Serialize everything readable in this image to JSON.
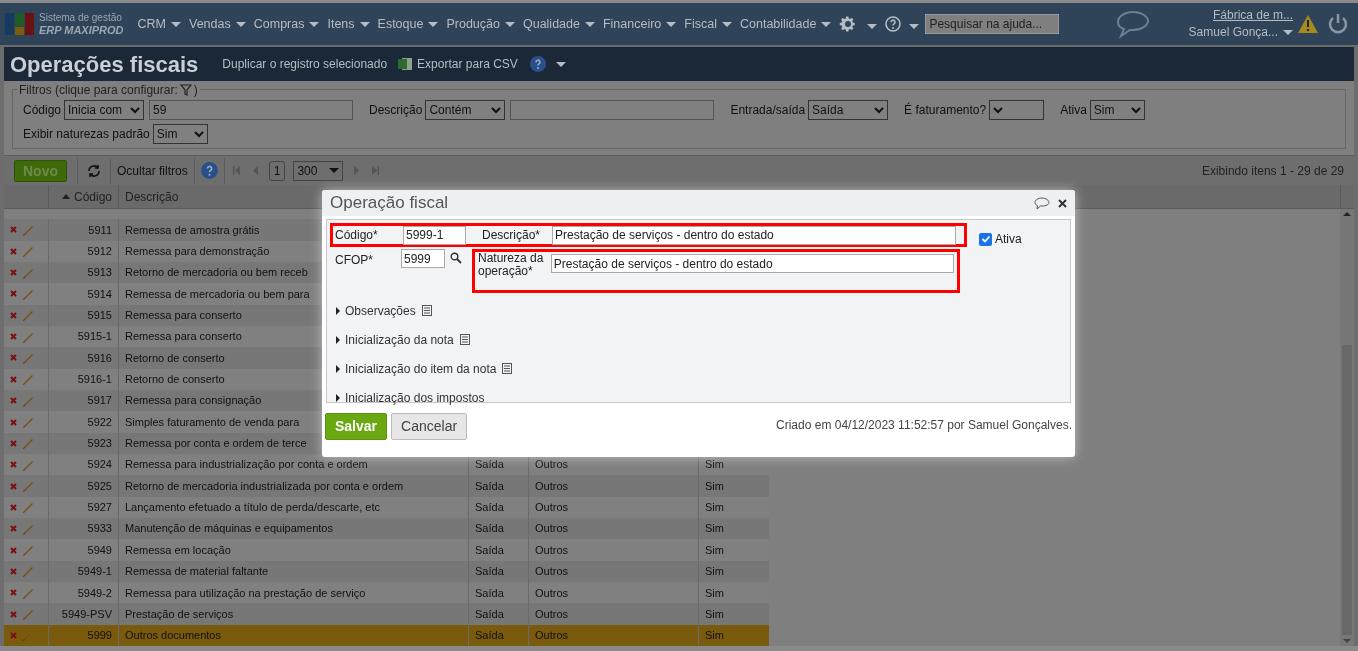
{
  "nav": {
    "logo_top": "Sistema de gestão",
    "logo_bottom": "ERP MAXIPROD",
    "menus": [
      "CRM",
      "Vendas",
      "Compras",
      "Itens",
      "Estoque",
      "Produção",
      "Qualidade",
      "Financeiro",
      "Fiscal",
      "Contabilidade"
    ],
    "help_search": {
      "placeholder": "Pesquisar na ajuda..."
    },
    "company": "Fábrica de m...",
    "user": "Samuel Gonça..."
  },
  "page": {
    "title": "Operações fiscais",
    "actions": [
      {
        "kind": "duplicate",
        "label": "Duplicar o registro selecionado"
      },
      {
        "kind": "export",
        "label": "Exportar para CSV"
      }
    ]
  },
  "filters": {
    "legend_start": "Filtros (clique para configurar:",
    "legend_end": ")",
    "rows": [
      [
        {
          "kind": "text",
          "label": "Código",
          "operator": "Inicia com",
          "value": "59"
        },
        {
          "kind": "text",
          "label": "Descrição",
          "operator": "Contém"
        },
        {
          "kind": "select",
          "label": "Entrada/saída",
          "operator": "Saída"
        },
        {
          "kind": "select",
          "label": "É faturamento?"
        },
        {
          "kind": "select",
          "label": "Ativa",
          "operator": "Sim"
        }
      ],
      [
        {
          "kind": "select",
          "label": "Exibir naturezas padrão",
          "operator": "Sim"
        }
      ]
    ]
  },
  "toolbar": {
    "new": "Novo",
    "hide_filters": "Ocultar filtros",
    "page": "1",
    "page_size": "300",
    "status": "Exibindo itens 1 - 29 de 29"
  },
  "table": {
    "columns": [
      "Código",
      "Descrição"
    ],
    "rows": [
      {
        "code": "5911",
        "description": "Remessa de amostra grátis",
        "selected": false
      },
      {
        "code": "5912",
        "description": "Remessa para demonstração",
        "selected": false
      },
      {
        "code": "5913",
        "description": "Retorno de mercadoria ou bem receb",
        "selected": false
      },
      {
        "code": "5914",
        "description": "Remessa de mercadoria ou bem para",
        "selected": false
      },
      {
        "code": "5915",
        "description": "Remessa para conserto",
        "selected": false
      },
      {
        "code": "5915-1",
        "description": "Remessa para conserto",
        "selected": false
      },
      {
        "code": "5916",
        "description": "Retorno de conserto",
        "selected": false
      },
      {
        "code": "5916-1",
        "description": "Retorno de conserto",
        "selected": false
      },
      {
        "code": "5917",
        "description": "Remessa para consignação",
        "selected": false
      },
      {
        "code": "5922",
        "description": "Simples faturamento de venda para",
        "selected": false
      },
      {
        "code": "5923",
        "description": "Remessa por conta e ordem de terce",
        "selected": false
      },
      {
        "code": "5924",
        "description": "Remessa para industrialização por conta e ordem",
        "direction": "Saída",
        "nature": "Outros",
        "active": "Sim",
        "selected": false
      },
      {
        "code": "5925",
        "description": "Retorno de mercadoria industrializada por conta e ordem",
        "direction": "Saída",
        "nature": "Outros",
        "active": "Sim",
        "selected": false
      },
      {
        "code": "5927",
        "description": "Lançamento efetuado a título de perda/descarte, etc",
        "direction": "Saída",
        "nature": "Outros",
        "active": "Sim",
        "selected": false
      },
      {
        "code": "5933",
        "description": "Manutenção de máquinas e equipamentos",
        "direction": "Saída",
        "nature": "Outros",
        "active": "Sim",
        "selected": false
      },
      {
        "code": "5949",
        "description": "Remessa em locação",
        "direction": "Saída",
        "nature": "Outros",
        "active": "Sim",
        "selected": false
      },
      {
        "code": "5949-1",
        "description": "Remessa de material faltante",
        "direction": "Saída",
        "nature": "Outros",
        "active": "Sim",
        "selected": false
      },
      {
        "code": "5949-2",
        "description": "Remessa para utilização na prestação de serviço",
        "direction": "Saída",
        "nature": "Outros",
        "active": "Sim",
        "selected": false
      },
      {
        "code": "5949-PSV",
        "description": "Prestação de serviços",
        "direction": "Saída",
        "nature": "Outros",
        "active": "Sim",
        "selected": false
      },
      {
        "code": "5999",
        "description": "Outros documentos",
        "direction": "Saída",
        "nature": "Outros",
        "active": "Sim",
        "selected": true
      }
    ]
  },
  "modal": {
    "title": "Operação fiscal",
    "code_label": "Código*",
    "code": "5999-1",
    "description_label": "Descrição*",
    "description": "Prestação de serviços - dentro do estado",
    "active_label": "Ativa",
    "active": true,
    "cfop_label": "CFOP*",
    "cfop": "5999",
    "nature_label": "Natureza da operação*",
    "nature": "Prestação de serviços - dentro do estado",
    "sections": [
      {
        "label": "Observações",
        "note_icon": true
      },
      {
        "label": "Inicialização da nota",
        "note_icon": true
      },
      {
        "label": "Inicialização do item da nota",
        "note_icon": true
      },
      {
        "label": "Inicialização dos impostos",
        "note_icon": false
      }
    ],
    "save": "Salvar",
    "cancel": "Cancelar",
    "footer": "Criado em 04/12/2023 11:52:57 por Samuel Gonçalves."
  }
}
